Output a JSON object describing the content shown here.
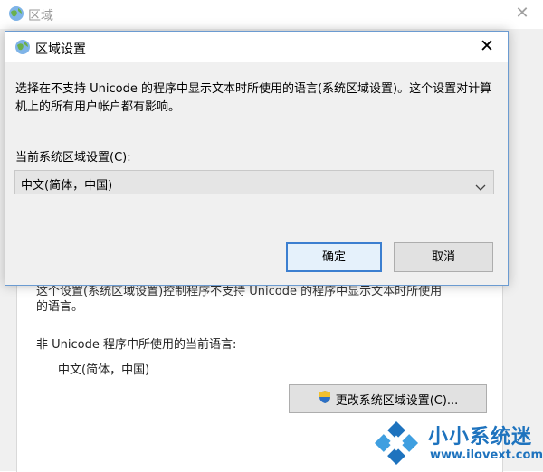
{
  "parent": {
    "title": "区域",
    "partial_line": "这个设置(系统区域设置)控制程序不支持 Unicode 的程序中显示文本时所使用",
    "desc_line2": "的语言。",
    "non_unicode_label": "非 Unicode 程序中所使用的当前语言:",
    "current_language": "中文(简体，中国)",
    "change_button": "更改系统区域设置(C)..."
  },
  "dialog": {
    "title": "区域设置",
    "description": "选择在不支持 Unicode 的程序中显示文本时所使用的语言(系统区域设置)。这个设置对计算机上的所有用户帐户都有影响。",
    "select_label": "当前系统区域设置(C):",
    "select_value": "中文(简体，中国)",
    "ok_label": "确定",
    "cancel_label": "取消"
  },
  "watermark": {
    "title": "小小系统迷",
    "url": "www.ilovext.com"
  },
  "colors": {
    "accent": "#3c7fd0",
    "watermark": "#1e73be"
  },
  "icons": {
    "window": "globe-icon",
    "close": "close-icon",
    "dropdown": "chevron-down-icon",
    "admin": "shield-icon"
  }
}
